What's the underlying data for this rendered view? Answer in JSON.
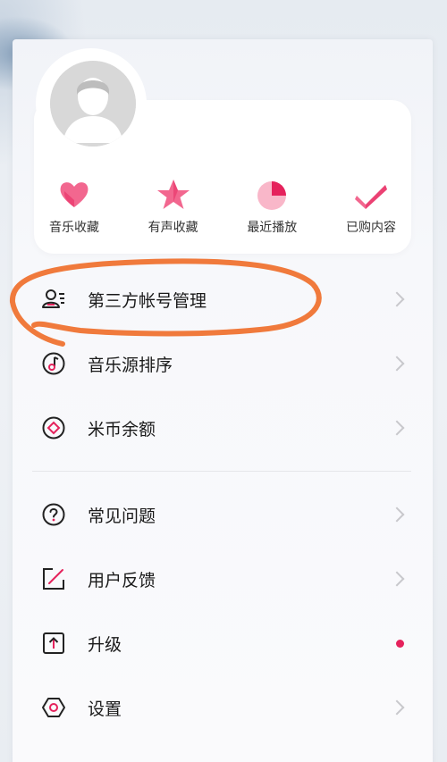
{
  "accent_color": "#e5225c",
  "annotation_color": "#f07a3c",
  "shortcuts": [
    {
      "label": "音乐收藏",
      "icon": "heart-icon"
    },
    {
      "label": "有声收藏",
      "icon": "star-icon"
    },
    {
      "label": "最近播放",
      "icon": "pie-clock-icon"
    },
    {
      "label": "已购内容",
      "icon": "checkmark-icon"
    }
  ],
  "menu_group1": [
    {
      "label": "第三方帐号管理",
      "icon": "account-manage-icon"
    },
    {
      "label": "音乐源排序",
      "icon": "music-note-icon"
    },
    {
      "label": "米币余额",
      "icon": "coin-diamond-icon"
    }
  ],
  "menu_group2": [
    {
      "label": "常见问题",
      "icon": "question-icon"
    },
    {
      "label": "用户反馈",
      "icon": "edit-icon"
    },
    {
      "label": "升级",
      "icon": "upgrade-arrow-icon"
    },
    {
      "label": "设置",
      "icon": "settings-hexagon-icon"
    }
  ]
}
